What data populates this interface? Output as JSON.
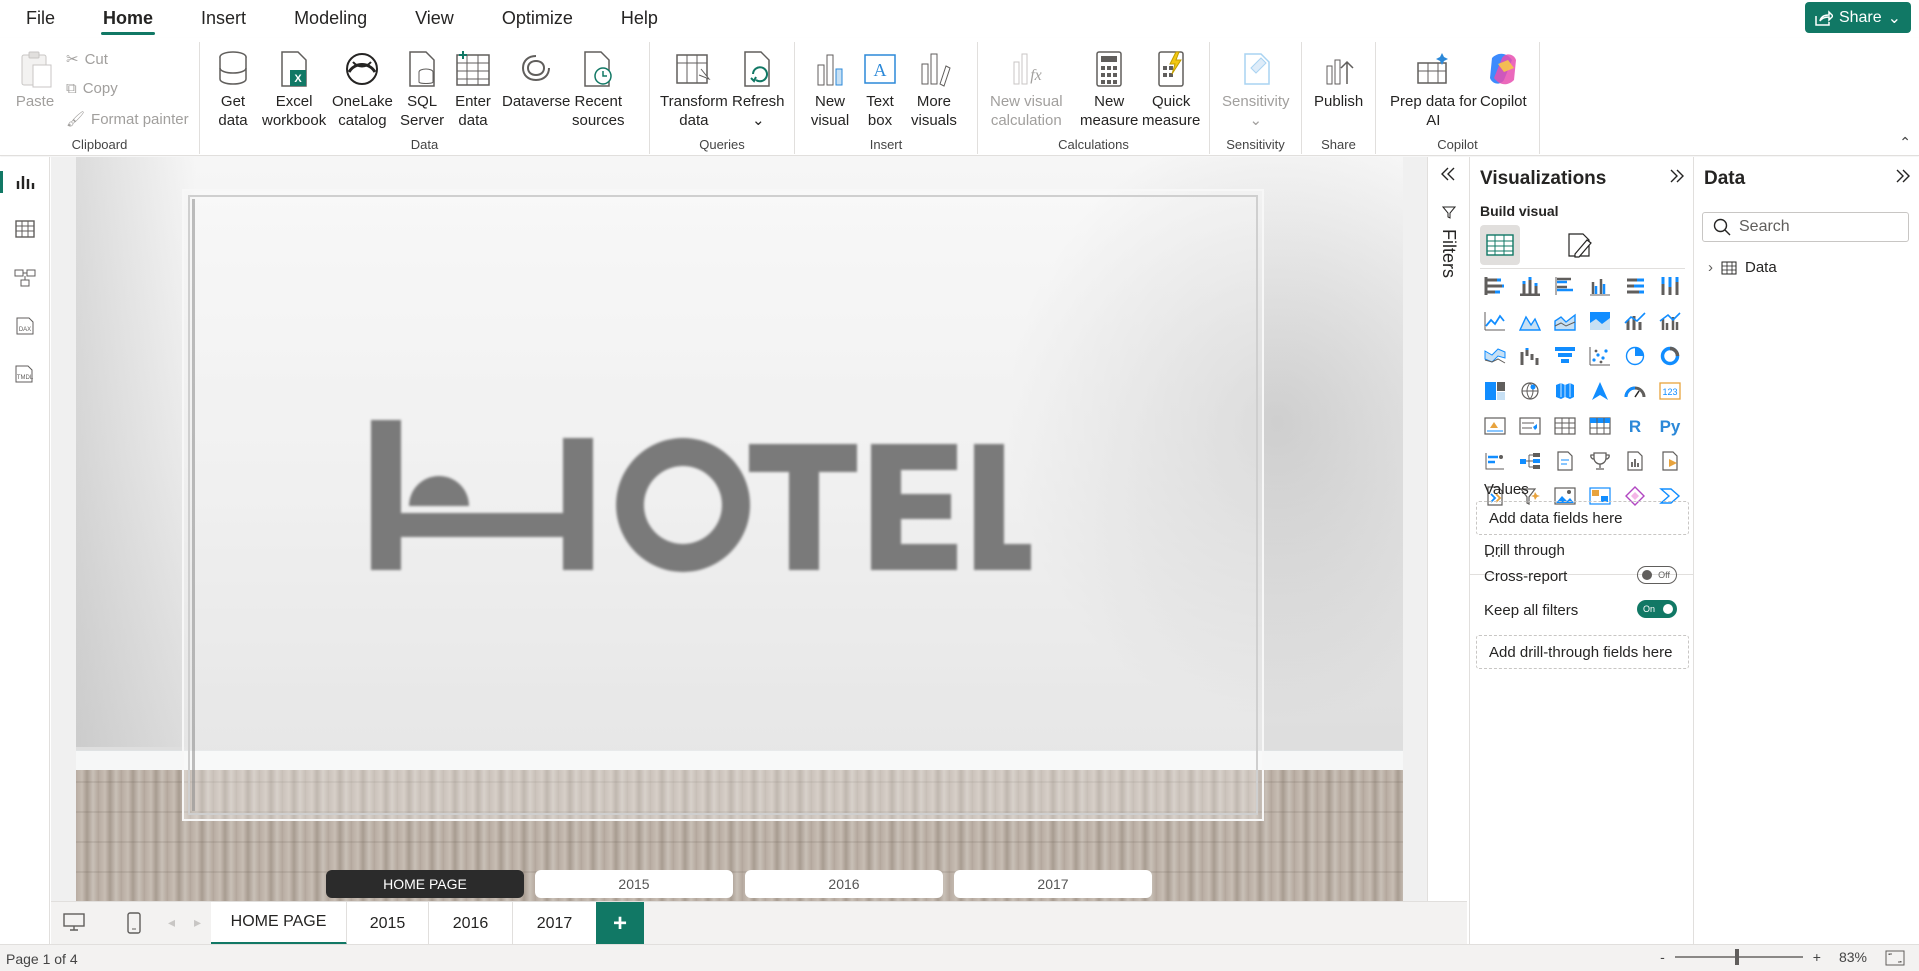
{
  "menu": {
    "items": [
      "File",
      "Home",
      "Insert",
      "Modeling",
      "View",
      "Optimize",
      "Help"
    ],
    "active": "Home"
  },
  "share": {
    "label": "Share"
  },
  "ribbon": {
    "clipboard": {
      "label": "Clipboard",
      "paste": "Paste",
      "cut": "Cut",
      "copy": "Copy",
      "format_painter": "Format painter"
    },
    "data": {
      "label": "Data",
      "get_data": [
        "Get",
        "data"
      ],
      "excel": [
        "Excel",
        "workbook"
      ],
      "onelake": [
        "OneLake",
        "catalog"
      ],
      "sql": [
        "SQL",
        "Server"
      ],
      "enter": [
        "Enter",
        "data"
      ],
      "dataverse": "Dataverse",
      "recent": [
        "Recent",
        "sources"
      ]
    },
    "queries": {
      "label": "Queries",
      "transform": [
        "Transform",
        "data"
      ],
      "refresh": "Refresh"
    },
    "insert": {
      "label": "Insert",
      "new_visual": [
        "New",
        "visual"
      ],
      "text_box": [
        "Text",
        "box"
      ],
      "more_visuals": [
        "More",
        "visuals"
      ]
    },
    "calculations": {
      "label": "Calculations",
      "new_visual_calc": [
        "New visual",
        "calculation"
      ],
      "new_measure": [
        "New",
        "measure"
      ],
      "quick_measure": [
        "Quick",
        "measure"
      ]
    },
    "sensitivity": {
      "label": "Sensitivity",
      "sensitivity": "Sensitivity"
    },
    "share": {
      "label": "Share",
      "publish": "Publish"
    },
    "copilot": {
      "label": "Copilot",
      "prep": [
        "Prep data for",
        "AI"
      ],
      "copilot": "Copilot"
    }
  },
  "canvas": {
    "logo_text": "HOTEL",
    "nav_buttons": [
      "HOME PAGE",
      "2015",
      "2016",
      "2017"
    ]
  },
  "page_tabs": {
    "tabs": [
      "HOME PAGE",
      "2015",
      "2016",
      "2017"
    ],
    "active": "HOME PAGE",
    "add": "+"
  },
  "status": {
    "page": "Page 1 of 4",
    "zoom": "83%",
    "minus": "-",
    "plus": "+"
  },
  "filters": {
    "label": "Filters"
  },
  "visualizations": {
    "title": "Visualizations",
    "build_visual": "Build visual",
    "values_label": "Values",
    "values_placeholder": "Add data fields here",
    "drill_through": "Drill through",
    "cross_report": "Cross-report",
    "cross_report_state": "Off",
    "keep_all_filters": "Keep all filters",
    "keep_all_filters_state": "On",
    "drill_placeholder": "Add drill-through fields here",
    "more": "···"
  },
  "data_pane": {
    "title": "Data",
    "search_placeholder": "Search",
    "table": "Data"
  },
  "colors": {
    "accent": "#117865",
    "nav_home": "#2b2b2b"
  }
}
